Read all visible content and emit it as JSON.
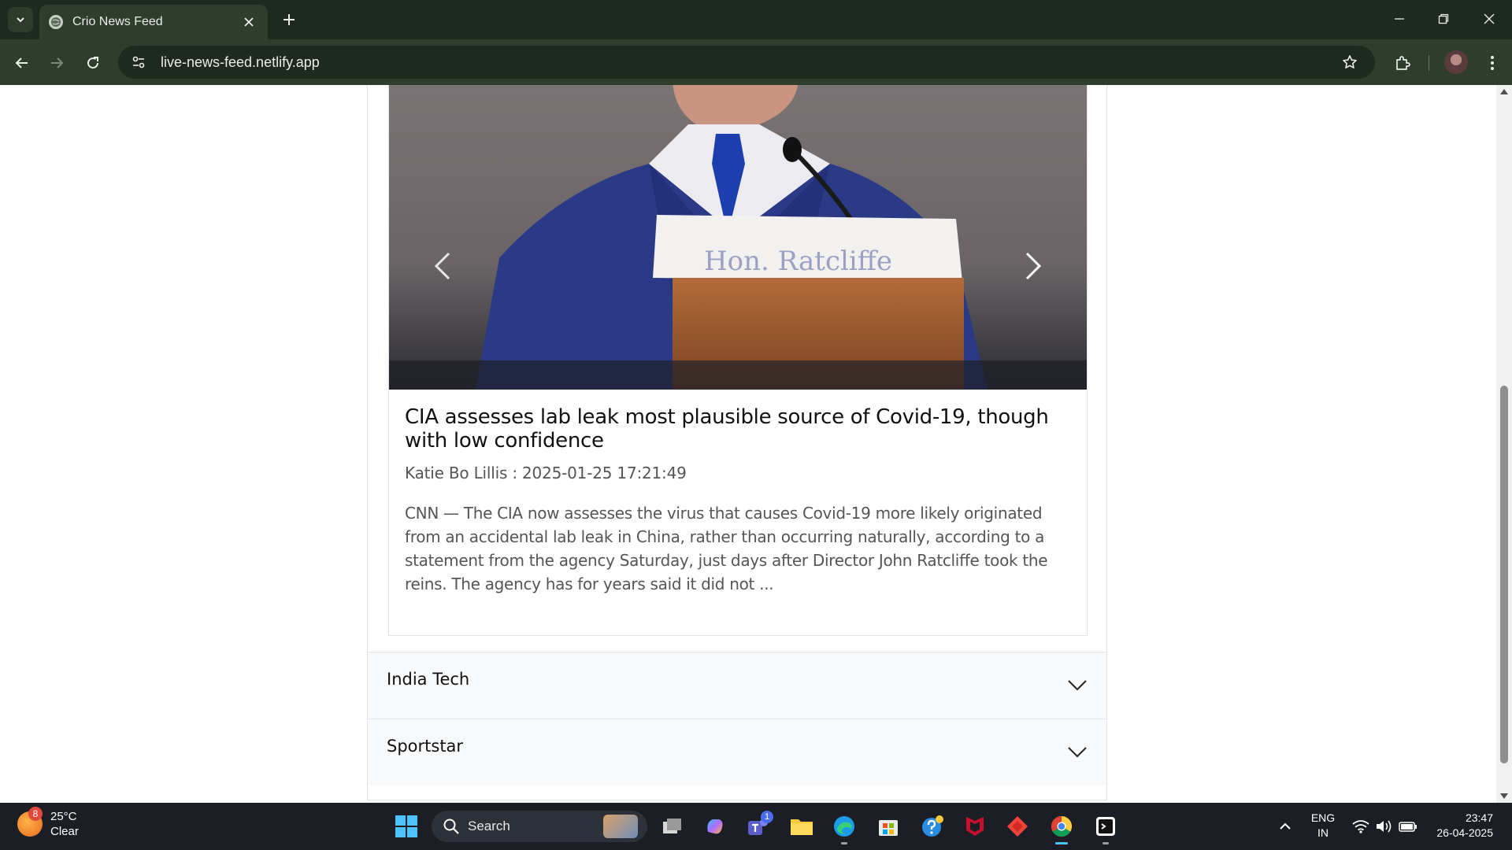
{
  "browser": {
    "tab_title": "Crio News Feed",
    "url": "live-news-feed.netlify.app"
  },
  "article": {
    "image_placard": "Hon. Ratcliffe",
    "title": "CIA assesses lab leak most plausible source of Covid-19, though with low confidence",
    "meta": "Katie Bo Lillis : 2025-01-25 17:21:49",
    "description": "CNN — The CIA now assesses the virus that causes Covid-19 more likely originated from an accidental lab leak in China, rather than occurring naturally, according to a statement from the agency Saturday, just days after Director John Ratcliffe took the reins. The agency has for years said it did not ..."
  },
  "accordion": {
    "items": [
      {
        "label": "India Tech"
      },
      {
        "label": "Sportstar"
      }
    ]
  },
  "taskbar": {
    "weather_temp": "25°C",
    "weather_desc": "Clear",
    "weather_badge": "8",
    "search_label": "Search",
    "teams_badge": "1",
    "lang_top": "ENG",
    "lang_bottom": "IN",
    "time": "23:47",
    "date": "26-04-2025"
  },
  "colors": {
    "chrome_dark": "#1f2a1e",
    "chrome_toolbar": "#2e3d2c",
    "accordion_bg": "#f8f9fa",
    "taskbar_bg": "#1b1e24"
  }
}
